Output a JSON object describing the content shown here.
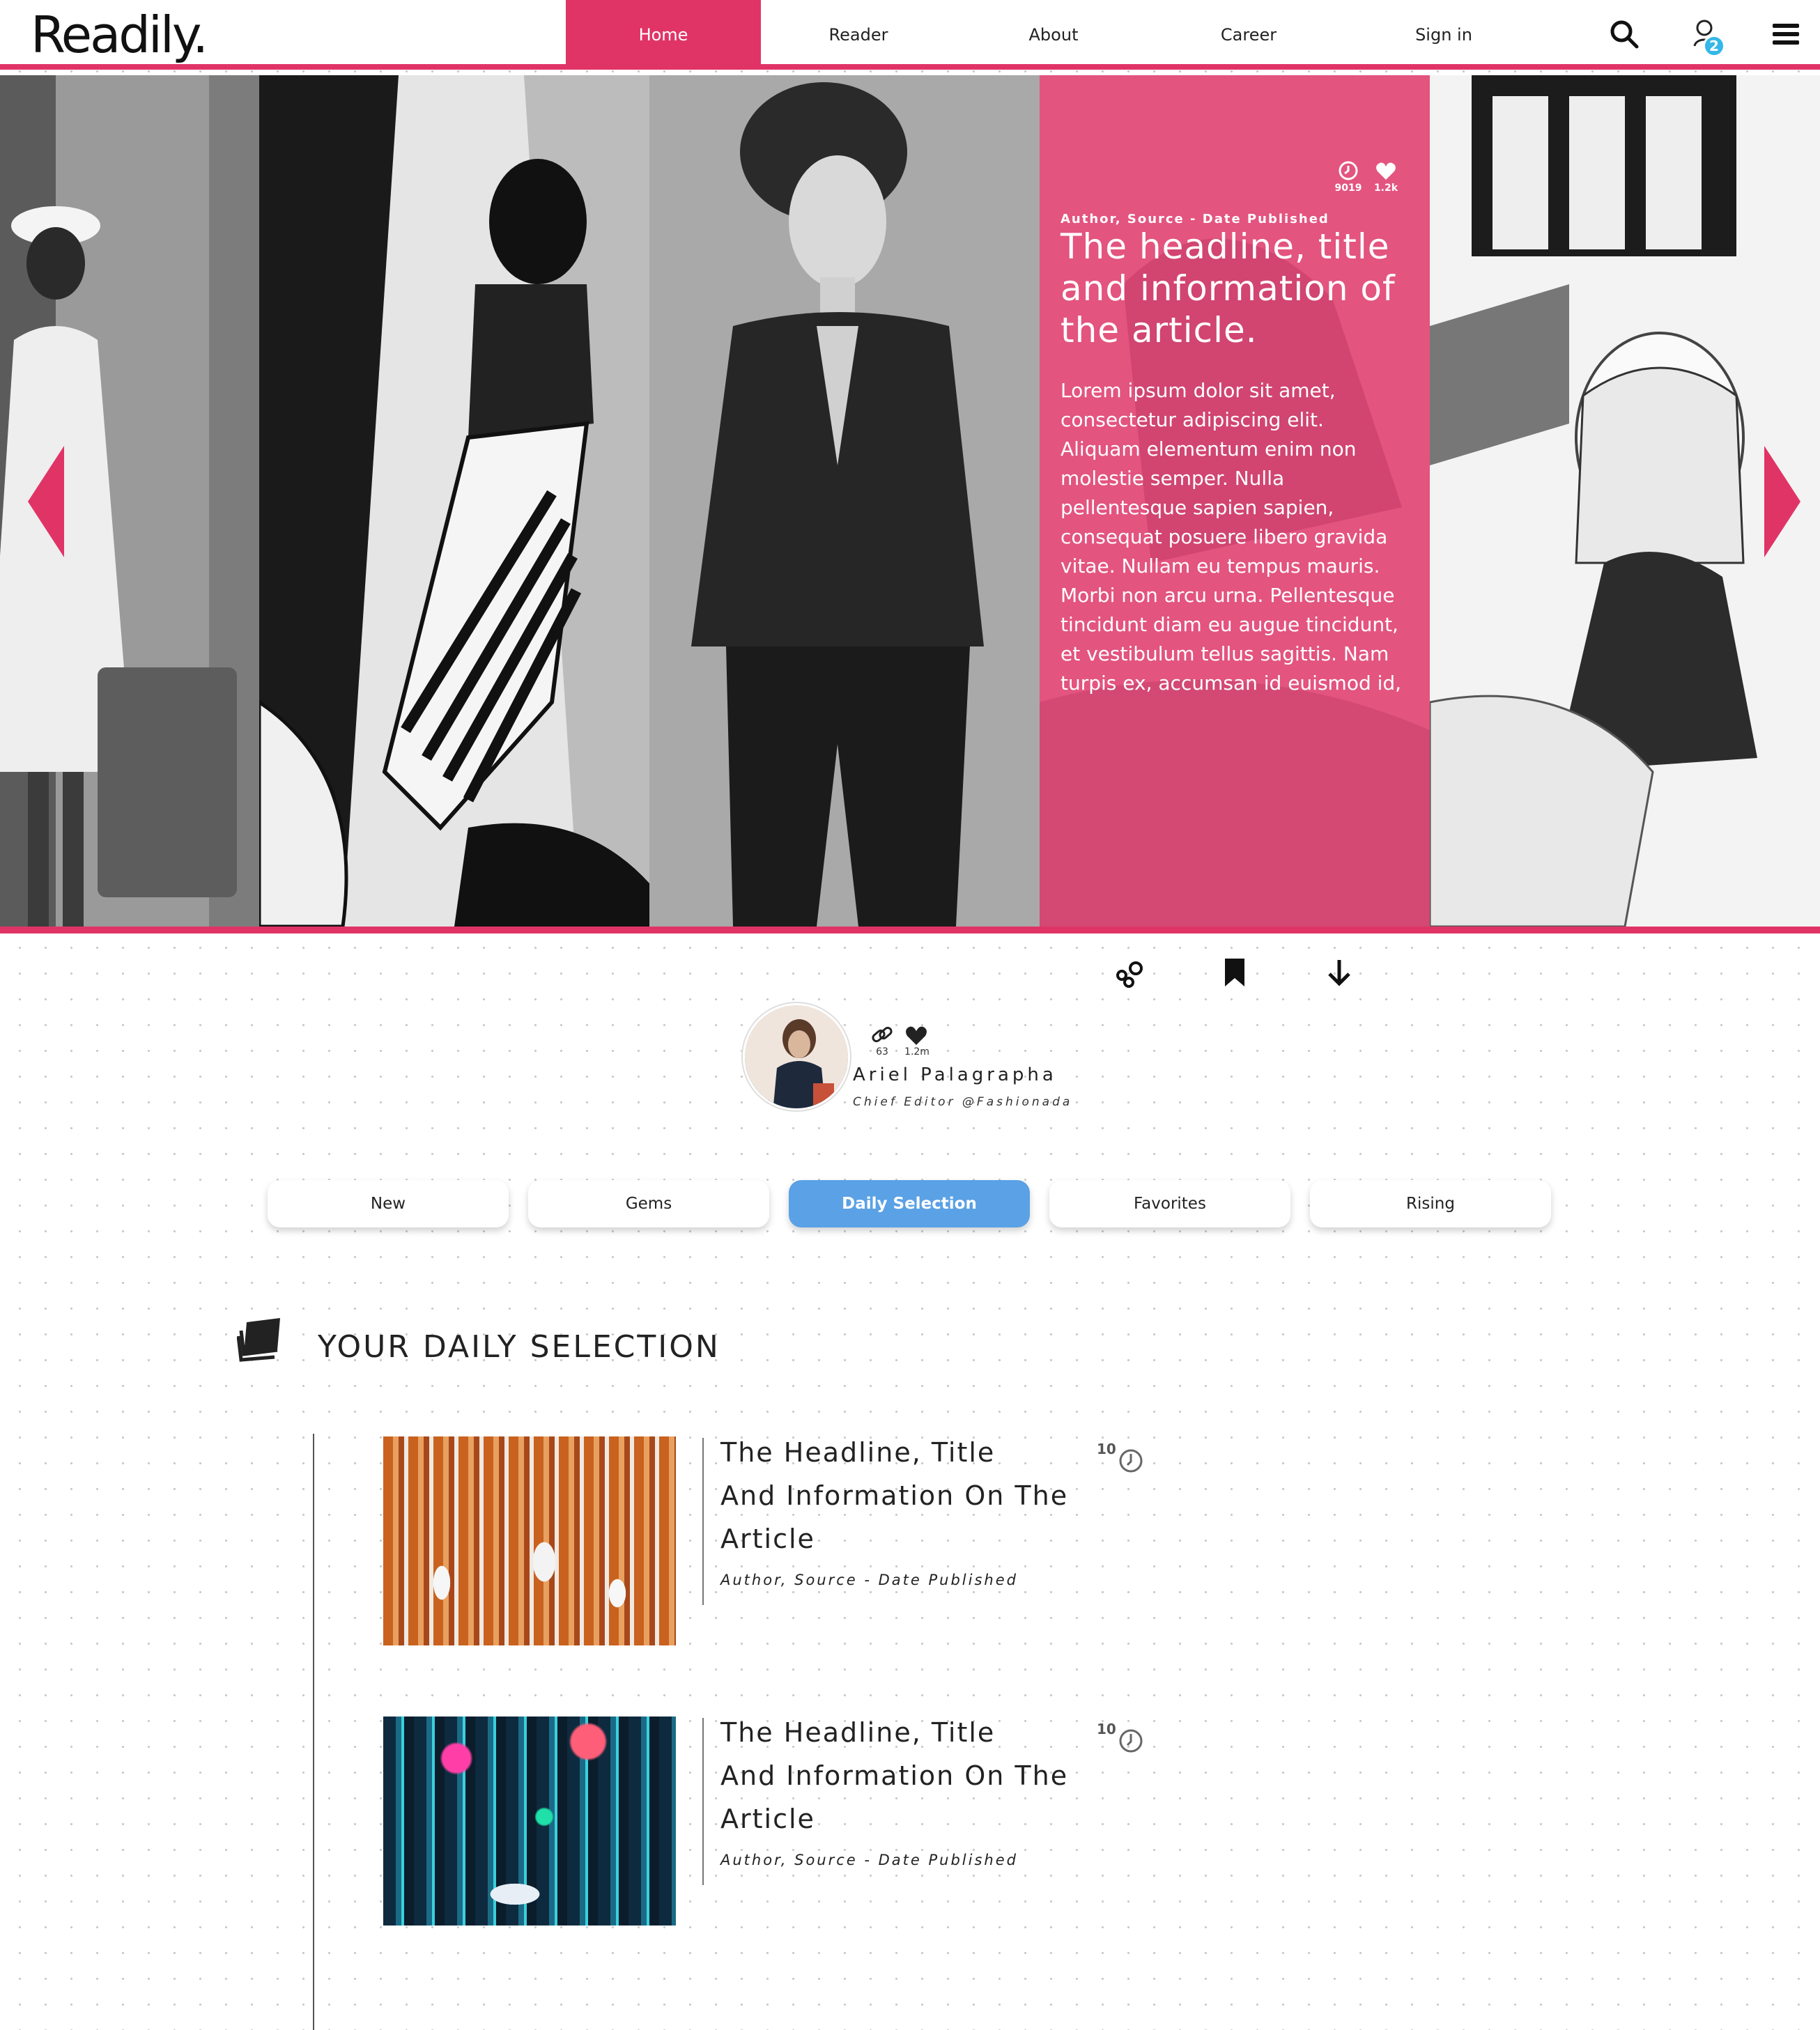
{
  "header": {
    "logo": "Readily.",
    "nav": [
      {
        "label": "Home",
        "active": true
      },
      {
        "label": "Reader"
      },
      {
        "label": "About"
      },
      {
        "label": "Career"
      },
      {
        "label": "Sign in"
      }
    ],
    "notification_count": "2",
    "icons": [
      "search-icon",
      "user-notification-icon",
      "hamburger-menu-icon"
    ],
    "accent_color": "#e03467"
  },
  "hero": {
    "featured": {
      "meta": "Author, Source - Date Published",
      "title": "The headline, title and information of the article.",
      "body": "Lorem ipsum dolor sit amet, consectetur adipiscing elit. Aliquam elementum enim non molestie semper. Nulla pellentesque sapien sapien, consequat posuere libero gravida vitae. Nullam eu tempus mauris. Morbi non arcu urna. Pellentesque tincidunt diam eu augue tincidunt, et vestibulum tellus sagittis. Nam turpis ex, accumsan id euismod id,",
      "reads": "9019",
      "likes": "1.2k",
      "card_color": "#e3547f"
    }
  },
  "actions": [
    "share-icon",
    "bookmark-icon",
    "download-icon"
  ],
  "author": {
    "name": "Ariel Palagrapha",
    "role": "Chief Editor @Fashionada",
    "links": "63",
    "likes": "1.2m"
  },
  "tabs": [
    {
      "label": "New"
    },
    {
      "label": "Gems"
    },
    {
      "label": "Daily Selection",
      "active": true
    },
    {
      "label": "Favorites"
    },
    {
      "label": "Rising"
    }
  ],
  "tab_active_color": "#5aa1e6",
  "section": {
    "title": "YOUR DAILY SELECTION"
  },
  "articles": [
    {
      "title_lines": [
        "The Headline, Title",
        "And Information On The",
        "Article"
      ],
      "meta": "Author, Source - Date Published",
      "read_time": "10"
    },
    {
      "title_lines": [
        "The Headline, Title",
        "And Information On The",
        "Article"
      ],
      "meta": "Author, Source - Date Published",
      "read_time": "10"
    }
  ]
}
